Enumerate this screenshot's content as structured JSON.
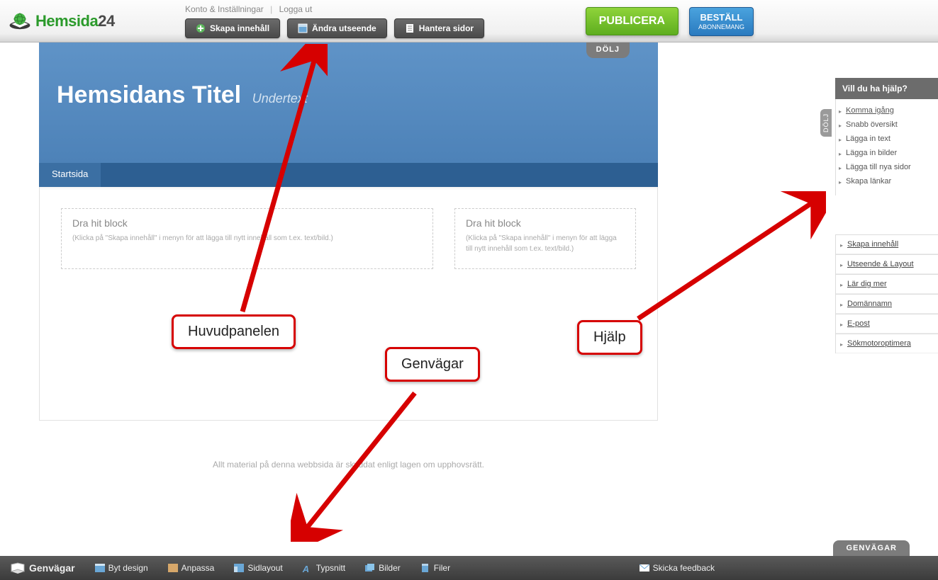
{
  "brand": {
    "name_part1": "Hemsida",
    "name_part2": "24"
  },
  "top_links": {
    "account": "Konto & Inställningar",
    "logout": "Logga ut"
  },
  "main_buttons": {
    "create": "Skapa innehåll",
    "appearance": "Ändra utseende",
    "pages": "Hantera sidor"
  },
  "actions": {
    "publish": "PUBLICERA",
    "order_l1": "BESTÄLL",
    "order_l2": "ABONNEMANG"
  },
  "site": {
    "title": "Hemsidans Titel",
    "subtitle": "Undertext",
    "dolj": "DÖLJ",
    "nav_home": "Startsida"
  },
  "drop": {
    "title": "Dra hit block",
    "hint_left": "(Klicka på \"Skapa innehåll\" i menyn för att lägga till nytt innehåll som t.ex. text/bild.)",
    "hint_right": "(Klicka på \"Skapa innehåll\" i menyn för att lägga till nytt innehåll som t.ex. text/bild.)"
  },
  "footer": "Allt material på denna webbsida är skyddat enligt lagen om upphovsrätt.",
  "annotations": {
    "main_panel": "Huvudpanelen",
    "shortcuts": "Genvägar",
    "help": "Hjälp"
  },
  "help_panel": {
    "title": "Vill du ha hjälp?",
    "dolj": "DÖLJ",
    "items1": [
      "Komma igång",
      "Snabb översikt",
      "Lägga in text",
      "Lägga in bilder",
      "Lägga till nya sidor",
      "Skapa länkar"
    ],
    "items2": [
      "Skapa innehåll",
      "Utseende & Layout",
      "Lär dig mer",
      "Domännamn",
      "E-post",
      "Sökmotoroptimera"
    ]
  },
  "shortbar": {
    "tab": "GENVÄGAR",
    "title": "Genvägar",
    "items": [
      "Byt design",
      "Anpassa",
      "Sidlayout",
      "Typsnitt",
      "Bilder",
      "Filer"
    ],
    "feedback": "Skicka feedback"
  }
}
